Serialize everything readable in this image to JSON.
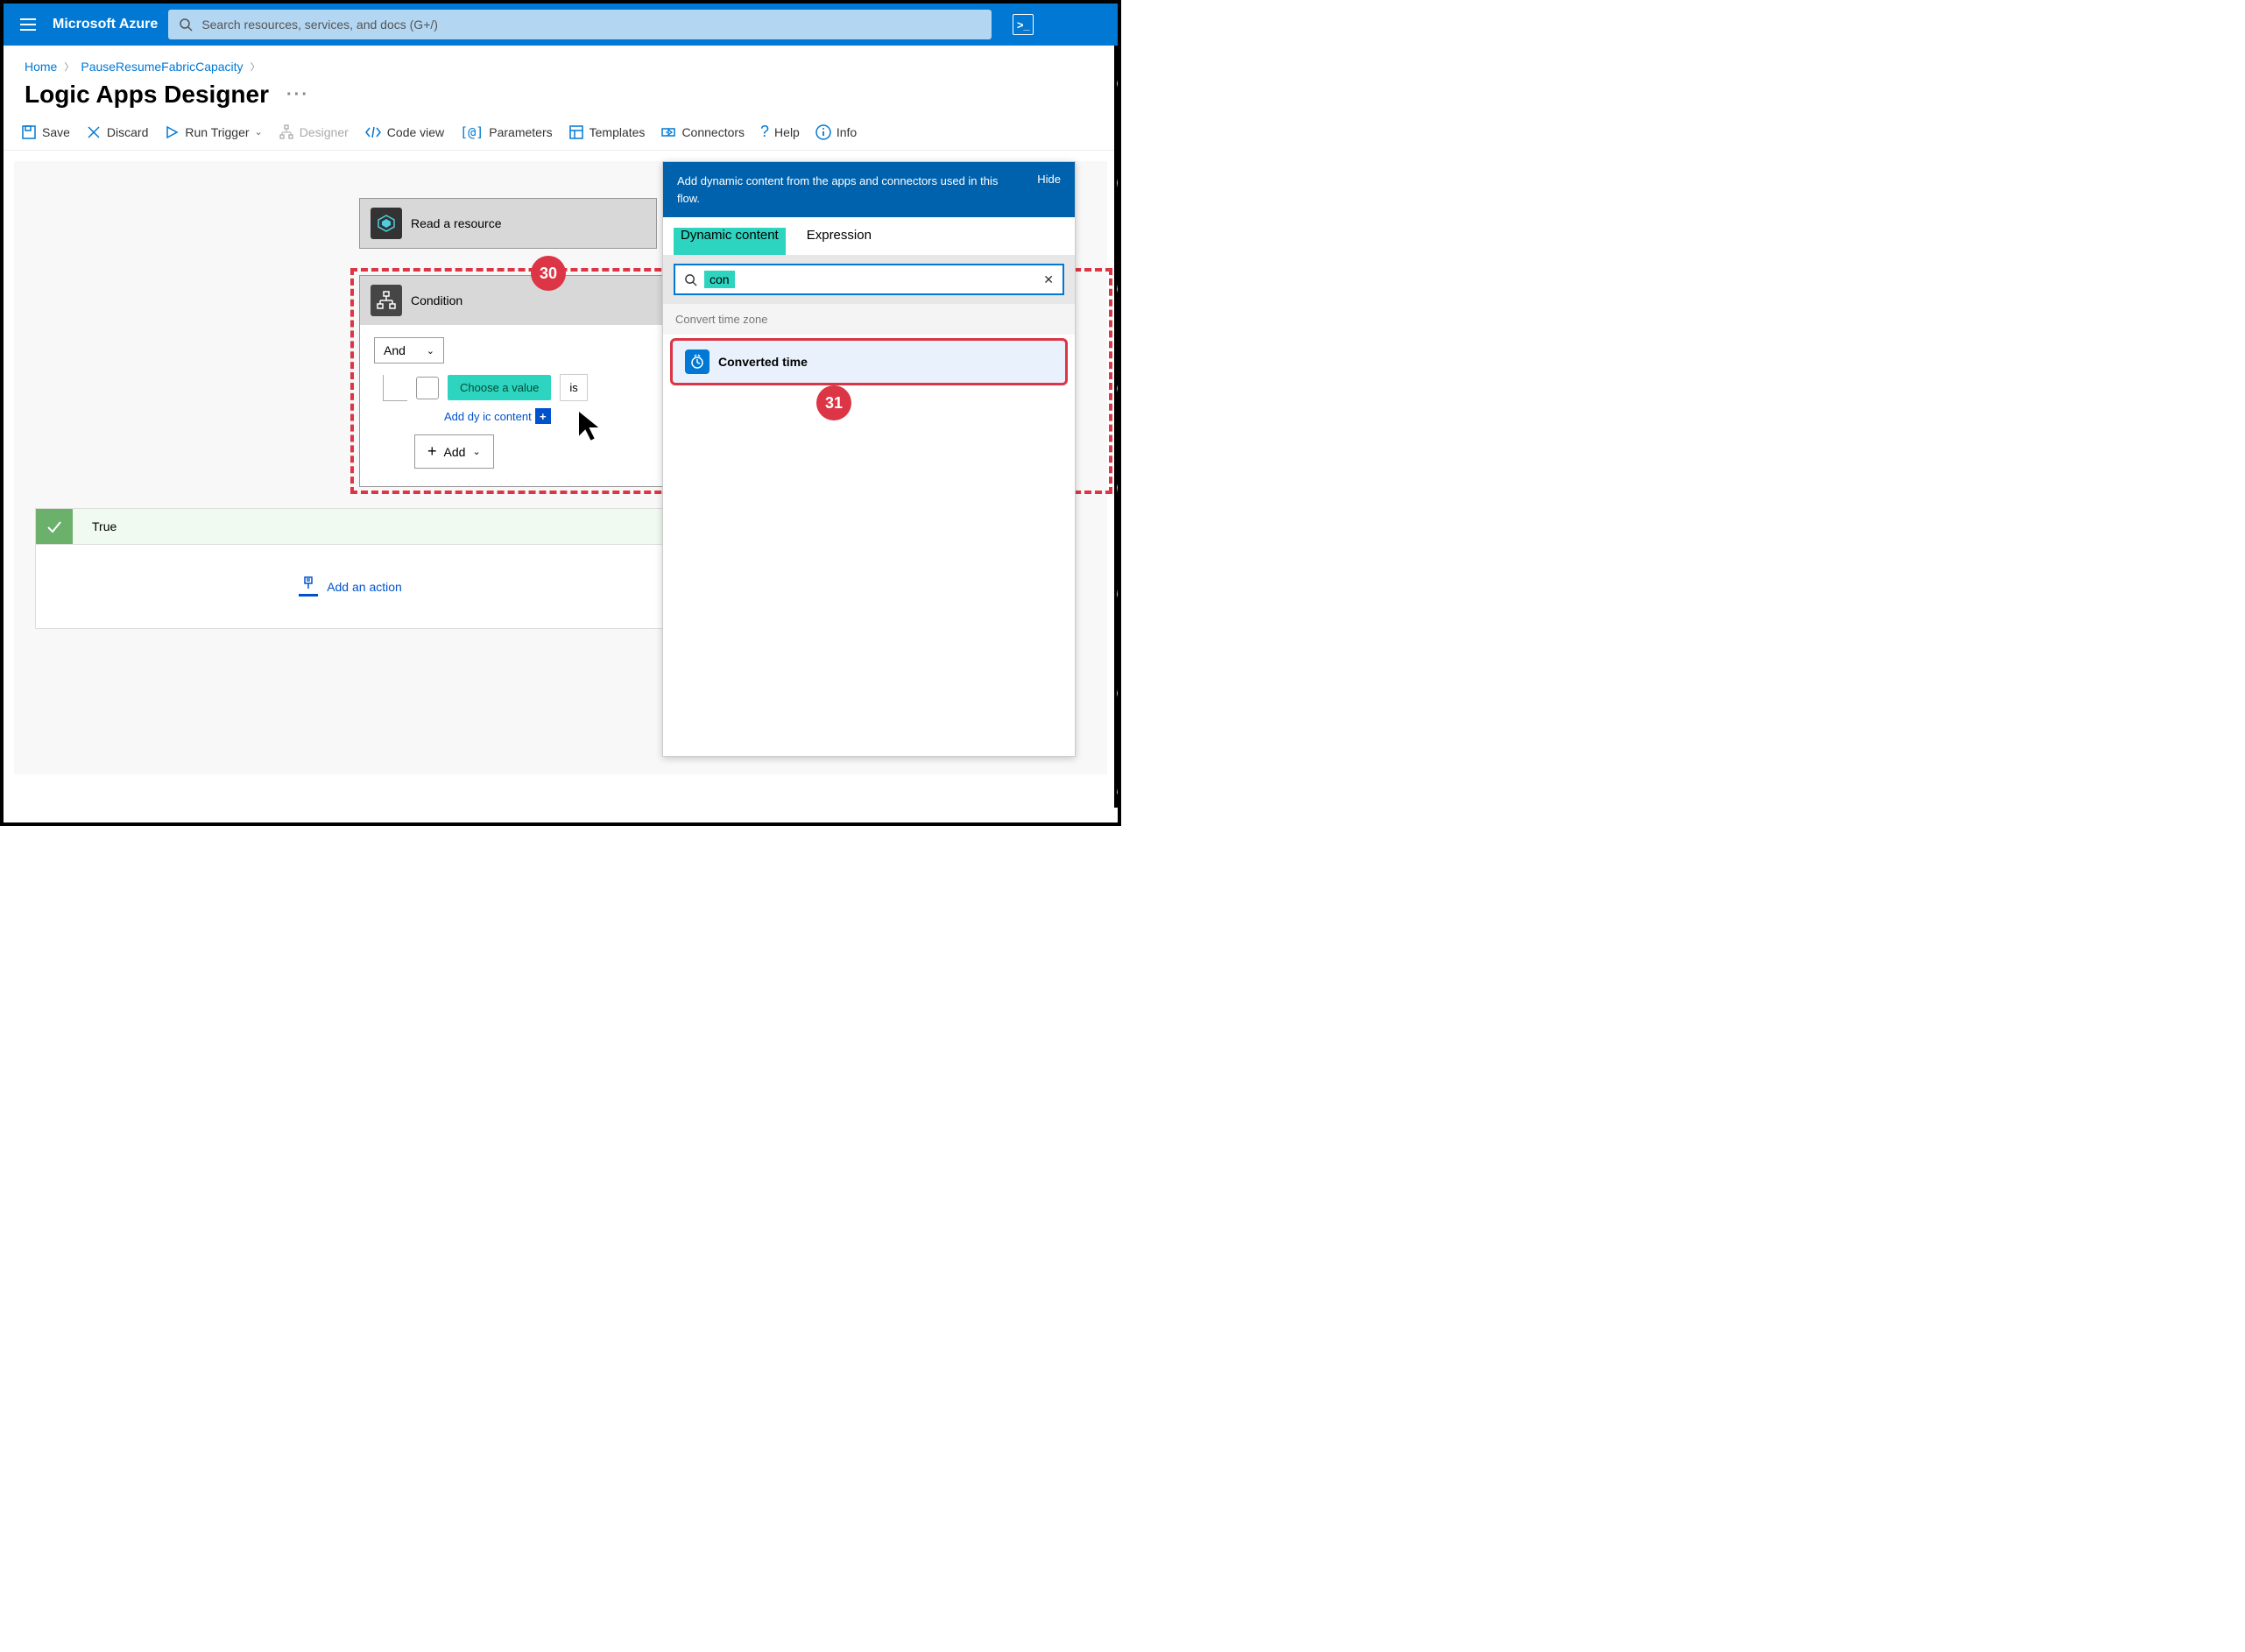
{
  "topbar": {
    "brand": "Microsoft Azure",
    "search_placeholder": "Search resources, services, and docs (G+/)"
  },
  "breadcrumb": {
    "home": "Home",
    "item": "PauseResumeFabricCapacity"
  },
  "page": {
    "title": "Logic Apps Designer"
  },
  "toolbar": {
    "save": "Save",
    "discard": "Discard",
    "run_trigger": "Run Trigger",
    "designer": "Designer",
    "code_view": "Code view",
    "parameters": "Parameters",
    "templates": "Templates",
    "connectors": "Connectors",
    "help": "Help",
    "info": "Info"
  },
  "cards": {
    "read_resource": "Read a resource",
    "condition": "Condition",
    "and": "And",
    "choose_value": "Choose a value",
    "is_equal": "is",
    "dynamic_link": "Add dy        ic content",
    "add": "Add"
  },
  "true_branch": {
    "label": "True",
    "add_action": "Add an action"
  },
  "popover": {
    "title": "Add dynamic content from the apps and connectors used in this flow.",
    "hide": "Hide",
    "tab_dynamic": "Dynamic content",
    "tab_expression": "Expression",
    "query": "con",
    "group": "Convert time zone",
    "item_name": "Converted time"
  },
  "callouts": {
    "c30": "30",
    "c31": "31"
  }
}
